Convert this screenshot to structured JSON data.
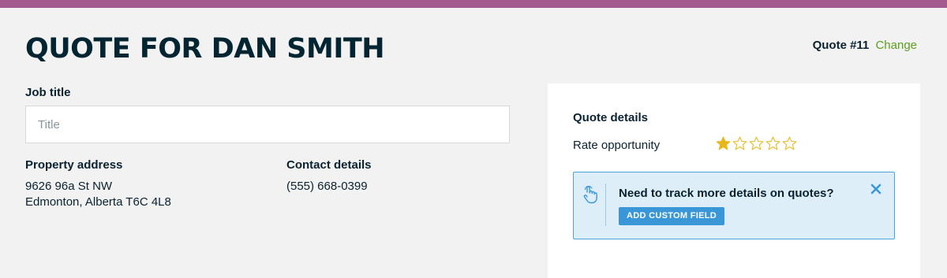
{
  "header": {
    "title": "QUOTE FOR DAN SMITH",
    "quote_number": "Quote #11",
    "change_link": "Change"
  },
  "form": {
    "job_title_label": "Job title",
    "job_title_placeholder": "Title",
    "job_title_value": "",
    "property": {
      "label": "Property address",
      "line1": "9626 96a St NW",
      "line2": "Edmonton, Alberta T6C 4L8"
    },
    "contact": {
      "label": "Contact details",
      "phone": "(555) 668-0399"
    }
  },
  "details_panel": {
    "heading": "Quote details",
    "rate_label": "Rate opportunity",
    "rating": {
      "value": 1,
      "max": 5
    },
    "promo": {
      "icon": "touch-icon",
      "text": "Need to track more details on quotes?",
      "button_label": "ADD CUSTOM FIELD"
    }
  },
  "colors": {
    "top_bar": "#a45a8e",
    "page_bg": "#f2f2f2",
    "heading": "#032532",
    "link": "#5c9e1e",
    "star_filled": "#e8b71a",
    "star_empty": "#e8b71a",
    "promo_bg": "#ddeef8",
    "promo_border": "#4ba3db",
    "promo_button": "#3a97d7"
  }
}
